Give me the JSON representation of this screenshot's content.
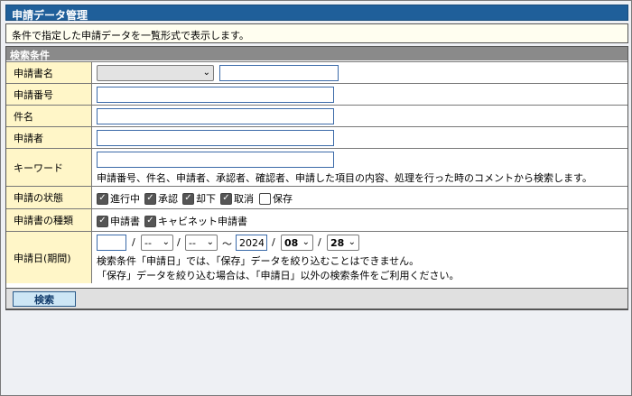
{
  "header": {
    "title": "申請データ管理"
  },
  "description": "条件で指定した申請データを一覧形式で表示します。",
  "search": {
    "section_title": "検索条件",
    "form_name": {
      "label": "申請書名",
      "select_value": "",
      "text_value": ""
    },
    "app_number": {
      "label": "申請番号",
      "value": ""
    },
    "subject": {
      "label": "件名",
      "value": ""
    },
    "applicant": {
      "label": "申請者",
      "value": ""
    },
    "keyword": {
      "label": "キーワード",
      "value": "",
      "hint": "申請番号、件名、申請者、承認者、確認者、申請した項目の内容、処理を行った時のコメントから検索します。"
    },
    "status": {
      "label": "申請の状態",
      "options": [
        {
          "label": "進行中",
          "checked": true
        },
        {
          "label": "承認",
          "checked": true
        },
        {
          "label": "却下",
          "checked": true
        },
        {
          "label": "取消",
          "checked": true
        },
        {
          "label": "保存",
          "checked": false
        }
      ]
    },
    "form_type": {
      "label": "申請書の種類",
      "options": [
        {
          "label": "申請書",
          "checked": true
        },
        {
          "label": "キャビネット申請書",
          "checked": true
        }
      ]
    },
    "date": {
      "label": "申請日(期間)",
      "from_year": "",
      "from_month": "-- ",
      "from_day": "-- ",
      "separator": "/",
      "range": "～",
      "to_year": "2024",
      "to_month": "08",
      "to_day": "28",
      "note1": "検索条件「申請日」では、「保存」データを絞り込むことはできません。",
      "note2": "「保存」データを絞り込む場合は、「申請日」以外の検索条件をご利用ください。"
    },
    "button": "検索"
  },
  "chev": "⌄"
}
